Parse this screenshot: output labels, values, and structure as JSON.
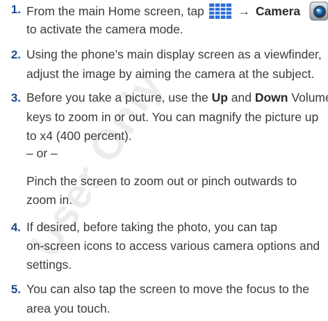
{
  "watermark": "User Only",
  "steps": [
    {
      "number": "1.",
      "line1_a": "From the main Home screen, tap",
      "arrow": "→",
      "line1_bold": "Camera",
      "line2": "to activate the camera mode.",
      "icons": [
        "apps-grid-icon",
        "camera-app-icon"
      ]
    },
    {
      "number": "2.",
      "line1": "Using the phone’s main display screen as a viewfinder,",
      "line2": "adjust the image by aiming the camera at the subject."
    },
    {
      "number": "3.",
      "line1_a": "Before you take a picture, use the",
      "line1_b1": "Up",
      "line1_mid": "and",
      "line1_b2": "Down",
      "line1_end": "Volume",
      "line2": "keys to zoom in or out. You can magnify the picture up",
      "line3": "to x4 (400 percent).",
      "or": "– or –",
      "line5": "Pinch the screen to zoom out or pinch outwards to",
      "line6": "zoom in."
    },
    {
      "number": "4.",
      "line1": "If desired, before taking the photo, you can tap",
      "line2": "on-screen icons to access various camera options and",
      "line3": "settings."
    },
    {
      "number": "5.",
      "line1": "You can also tap the screen to move the focus to the",
      "line2": "area you touch."
    }
  ],
  "colors": {
    "step_number": "#1b4a8c",
    "grid_icon": "#2a6fd6",
    "text": "#3b3b3b"
  }
}
